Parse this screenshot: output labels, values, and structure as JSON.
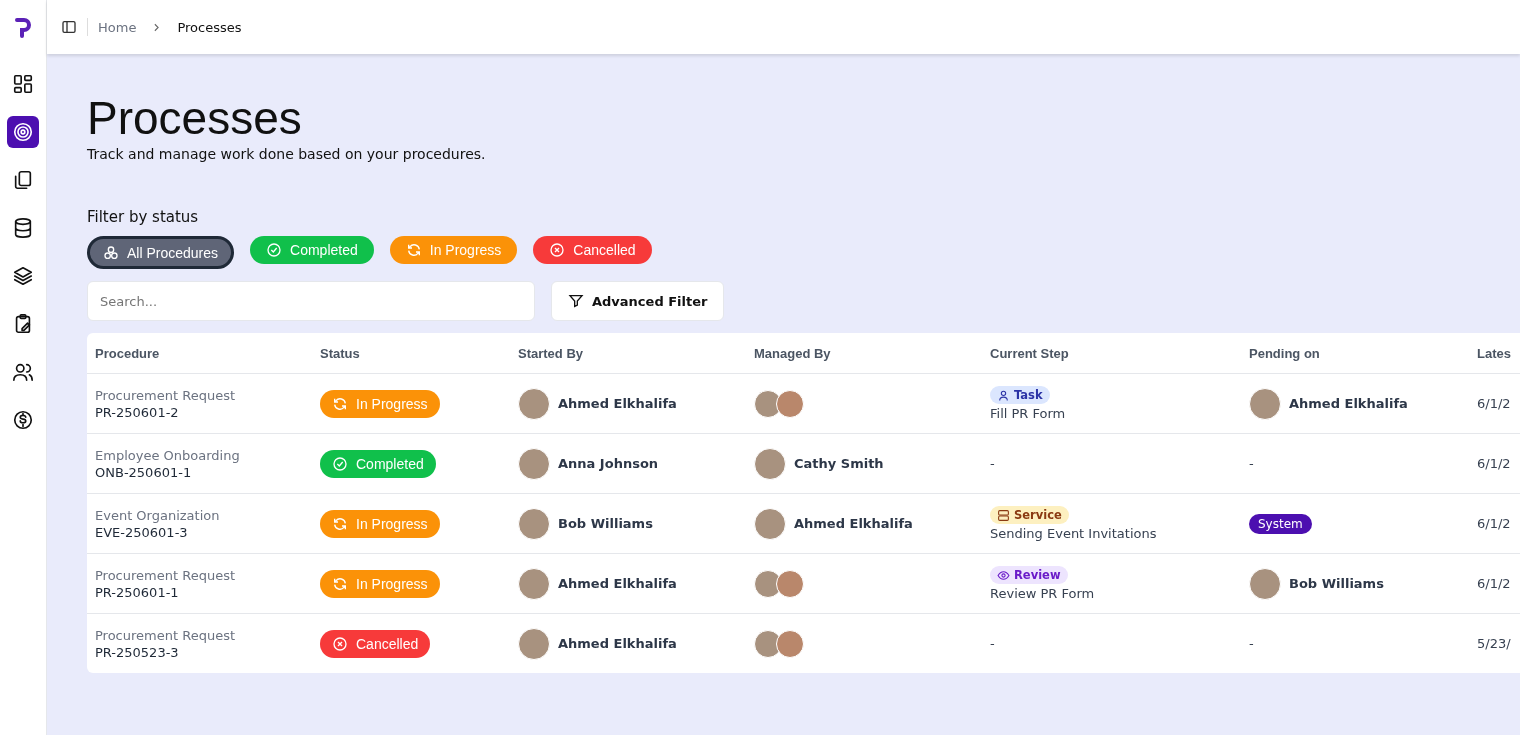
{
  "sidebar": {
    "items": [
      {
        "kind": "grid",
        "selected": false
      },
      {
        "kind": "target",
        "selected": true
      },
      {
        "kind": "copy",
        "selected": false
      },
      {
        "kind": "database",
        "selected": false
      },
      {
        "kind": "layers",
        "selected": false
      },
      {
        "kind": "clipboard",
        "selected": false
      },
      {
        "kind": "users",
        "selected": false
      },
      {
        "kind": "dollar",
        "selected": false
      }
    ]
  },
  "breadcrumb": [
    "Home",
    "Processes"
  ],
  "page": {
    "title": "Processes",
    "subtitle": "Track and manage work done based on your procedures."
  },
  "filter": {
    "label": "Filter by status",
    "chips": [
      {
        "kind": "all",
        "label": "All Procedures",
        "selected": true
      },
      {
        "kind": "completed",
        "label": "Completed",
        "selected": false
      },
      {
        "kind": "in_progress",
        "label": "In Progress",
        "selected": false
      },
      {
        "kind": "cancelled",
        "label": "Cancelled",
        "selected": false
      }
    ]
  },
  "search": {
    "placeholder": "Search..."
  },
  "advanced_filter": "Advanced Filter",
  "table": {
    "columns": [
      "Procedure",
      "Status",
      "Started By",
      "Managed By",
      "Current Step",
      "Pending on",
      "Lates"
    ],
    "rows": [
      {
        "procedure": "Procurement Request",
        "id": "PR-250601-2",
        "status": {
          "kind": "in_progress",
          "label": "In Progress"
        },
        "started_by": "Ahmed Elkhalifa",
        "managed_by": {
          "kind": "group"
        },
        "step": {
          "kind": "task",
          "badge": "Task",
          "name": "Fill PR Form"
        },
        "pending": {
          "kind": "person",
          "name": "Ahmed Elkhalifa"
        },
        "latest": "6/1/2"
      },
      {
        "procedure": "Employee Onboarding",
        "id": "ONB-250601-1",
        "status": {
          "kind": "completed",
          "label": "Completed"
        },
        "started_by": "Anna Johnson",
        "managed_by": {
          "kind": "person",
          "name": "Cathy Smith"
        },
        "step": {
          "kind": "none",
          "name": "-"
        },
        "pending": {
          "kind": "none",
          "name": "-"
        },
        "latest": "6/1/2"
      },
      {
        "procedure": "Event Organization",
        "id": "EVE-250601-3",
        "status": {
          "kind": "in_progress",
          "label": "In Progress"
        },
        "started_by": "Bob Williams",
        "managed_by": {
          "kind": "person",
          "name": "Ahmed Elkhalifa"
        },
        "step": {
          "kind": "service",
          "badge": "Service",
          "name": "Sending Event Invitations"
        },
        "pending": {
          "kind": "system",
          "name": "System"
        },
        "latest": "6/1/2"
      },
      {
        "procedure": "Procurement Request",
        "id": "PR-250601-1",
        "status": {
          "kind": "in_progress",
          "label": "In Progress"
        },
        "started_by": "Ahmed Elkhalifa",
        "managed_by": {
          "kind": "group"
        },
        "step": {
          "kind": "review",
          "badge": "Review",
          "name": "Review PR Form"
        },
        "pending": {
          "kind": "person",
          "name": "Bob Williams"
        },
        "latest": "6/1/2"
      },
      {
        "procedure": "Procurement Request",
        "id": "PR-250523-3",
        "status": {
          "kind": "cancelled",
          "label": "Cancelled"
        },
        "started_by": "Ahmed Elkhalifa",
        "managed_by": {
          "kind": "group"
        },
        "step": {
          "kind": "none",
          "name": "-"
        },
        "pending": {
          "kind": "none",
          "name": "-"
        },
        "latest": "5/23/"
      }
    ]
  }
}
